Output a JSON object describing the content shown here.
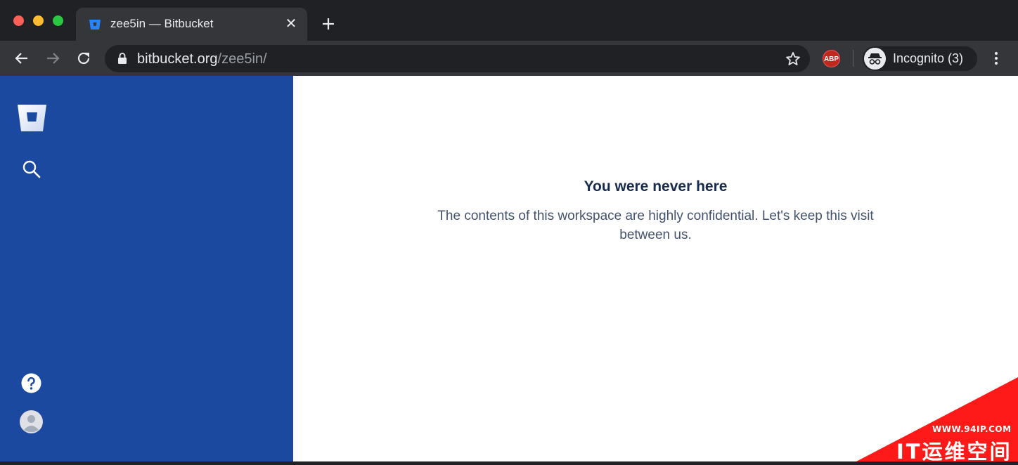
{
  "browser": {
    "tab": {
      "title": "zee5in — Bitbucket",
      "close_glyph": "✕"
    },
    "new_tab_icon": "plus-icon",
    "url": {
      "host": "bitbucket.org",
      "path": "/zee5in/"
    },
    "extension": {
      "label": "ABP"
    },
    "incognito": {
      "label": "Incognito (3)"
    }
  },
  "sidebar": {
    "logo": "bitbucket-logo",
    "items": [
      "search-icon",
      "help-icon",
      "avatar"
    ],
    "color": "#1c49a0"
  },
  "main": {
    "title": "You were never here",
    "description": "The contents of this workspace are highly confidential. Let's keep this visit between us."
  },
  "watermark": {
    "url": "WWW.94IP.COM",
    "text": "IT运维空间"
  }
}
